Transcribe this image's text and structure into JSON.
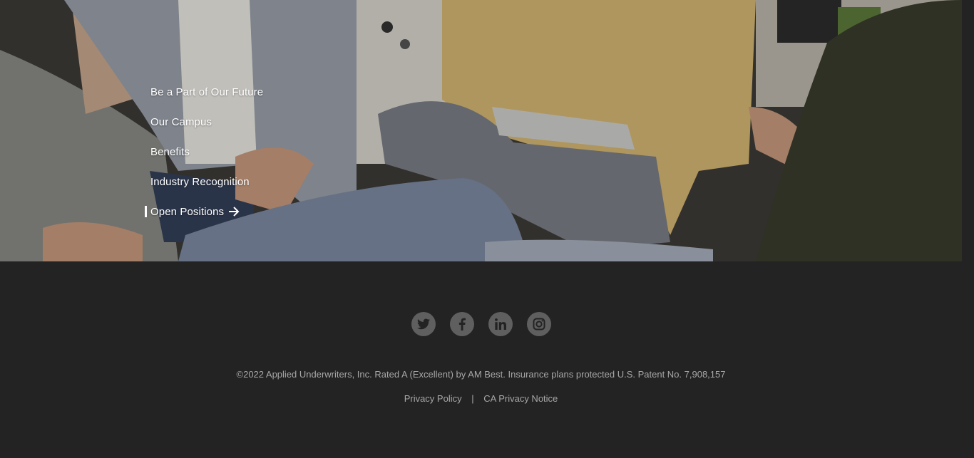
{
  "hero": {
    "image_alt": "Group of colleagues sitting together in a casual meeting",
    "nav": [
      {
        "label": "Be a Part of Our Future",
        "active": false
      },
      {
        "label": "Our Campus",
        "active": false
      },
      {
        "label": "Benefits",
        "active": false
      },
      {
        "label": "Industry Recognition",
        "active": false
      },
      {
        "label": "Open Positions",
        "active": true,
        "icon": "arrow-right-icon"
      }
    ]
  },
  "footer": {
    "social": [
      {
        "name": "twitter-icon"
      },
      {
        "name": "facebook-icon"
      },
      {
        "name": "linkedin-icon"
      },
      {
        "name": "instagram-icon"
      }
    ],
    "copyright": "©2022 Applied Underwriters, Inc. Rated A (Excellent) by AM Best. Insurance plans protected U.S. Patent No. 7,908,157",
    "links": {
      "privacy_policy": "Privacy Policy",
      "separator": "|",
      "ca_privacy_notice": "CA Privacy Notice"
    }
  },
  "colors": {
    "footer_bg": "#232323",
    "social_circle": "#5f5f5f",
    "footer_text": "#a7a7a7"
  }
}
